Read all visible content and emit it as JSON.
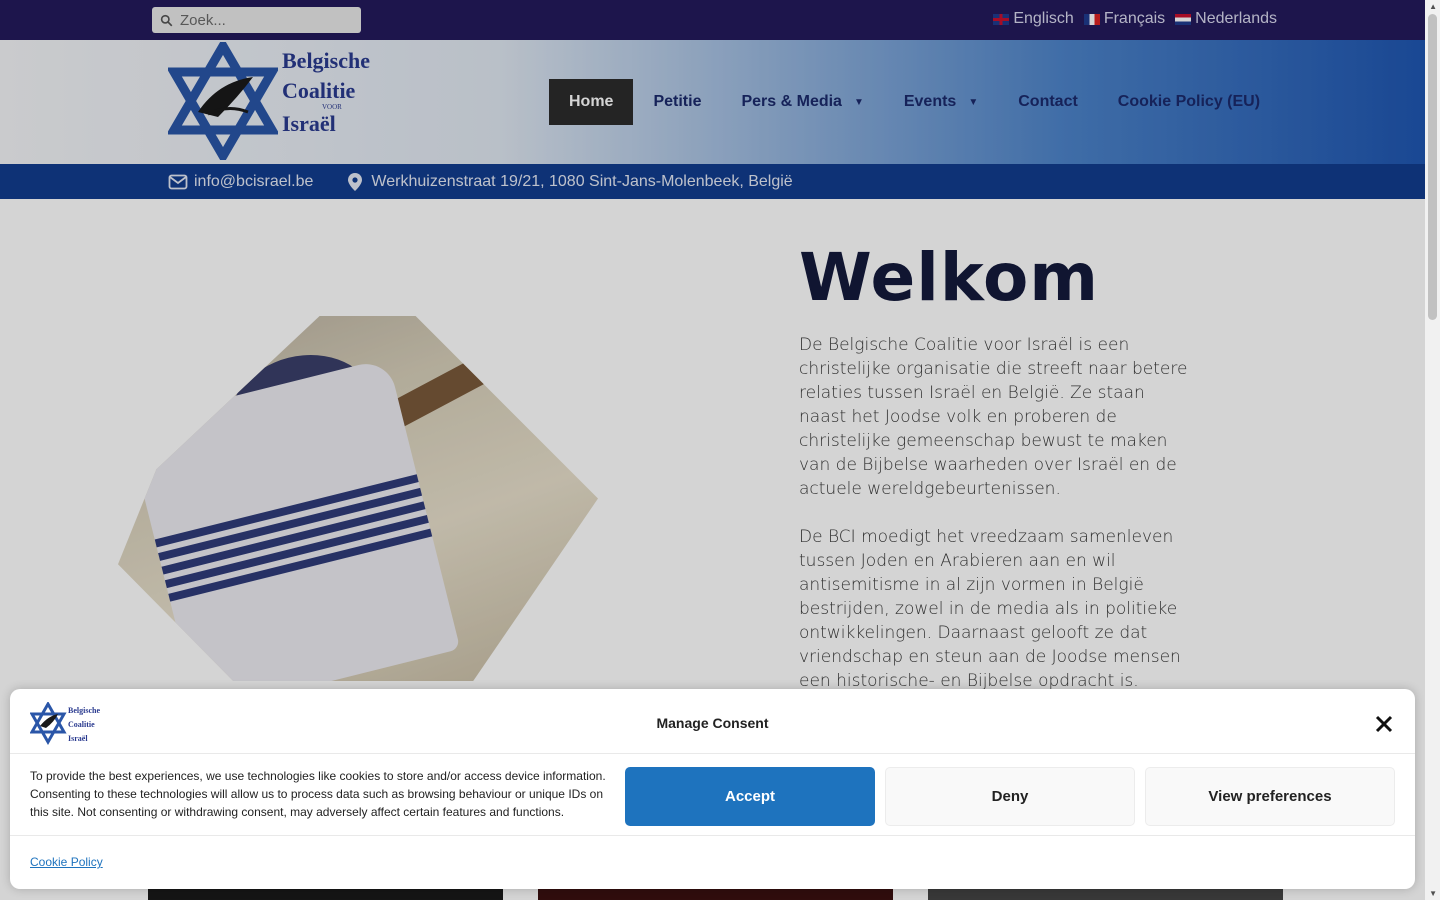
{
  "topbar": {
    "search_placeholder": "Zoek...",
    "languages": [
      {
        "label": "Englisch",
        "flag": "uk-flag-icon"
      },
      {
        "label": "Français",
        "flag": "fr-flag-icon"
      },
      {
        "label": "Nederlands",
        "flag": "nl-flag-icon"
      }
    ]
  },
  "header": {
    "logo": {
      "line1": "Belgische",
      "line2": "Coalitie",
      "voor": "VOOR",
      "line3": "Israël"
    },
    "nav": [
      {
        "label": "Home",
        "active": true
      },
      {
        "label": "Petitie"
      },
      {
        "label": "Pers & Media",
        "dropdown": true
      },
      {
        "label": "Events",
        "dropdown": true
      },
      {
        "label": "Contact"
      },
      {
        "label": "Cookie Policy (EU)"
      }
    ]
  },
  "contact": {
    "email": "info@bcisrael.be",
    "address": "Werkhuizenstraat 19/21, 1080 Sint-Jans-Molenbeek, België"
  },
  "main": {
    "title": "Welkom",
    "paragraph1": "De Belgische Coalitie voor Israël is een christelijke organisatie die streeft naar betere relaties tussen Israël en België. Ze staan naast het Joodse volk en proberen de christelijke gemeenschap bewust te maken van de Bijbelse waarheden over Israël en de actuele wereldgebeurtenissen.",
    "paragraph2": "De BCI moedigt het vreedzaam samenleven tussen Joden en Arabieren aan en wil antisemitisme in al zijn vormen in België bestrijden, zowel in de media als in politieke ontwikkelingen. Daarnaast gelooft ze dat vriendschap en steun aan de Joodse mensen een historische- en Bijbelse opdracht is."
  },
  "consent": {
    "title": "Manage Consent",
    "text": "To provide the best experiences, we use technologies like cookies to store and/or access device information. Consenting to these technologies will allow us to process data such as browsing behaviour or unique IDs on this site. Not consenting or withdrawing consent, may adversely affect certain features and functions.",
    "accept": "Accept",
    "deny": "Deny",
    "preferences": "View preferences",
    "cookie_link": "Cookie Policy"
  },
  "colors": {
    "topbar": "#241a5c",
    "contactbar": "#123d8f",
    "accent": "#1e73be"
  }
}
